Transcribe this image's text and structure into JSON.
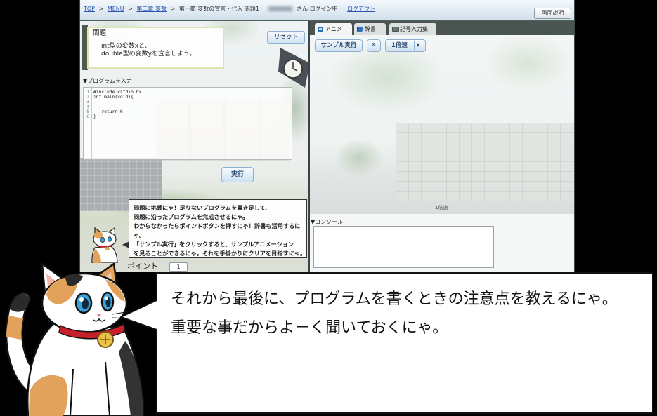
{
  "app": {
    "breadcrumb": {
      "top": "TOP",
      "sep1": ">",
      "menu": "MENU",
      "sep2": ">",
      "chapter": "第二章 変数",
      "sep3": ">",
      "section": "第一節 変数の宣言・代入 問題1",
      "user_suffix": "さん ログイン中",
      "logout": "ログアウト"
    },
    "help_button": "画面説明"
  },
  "editor_panel": {
    "problem": {
      "heading": "問題",
      "lines": [
        "int型の変数xと、",
        "double型の変数yを宣言しよう。"
      ]
    },
    "reset_button": "リセット",
    "program_label": "▼プログラムを入力",
    "code": {
      "line_numbers": [
        "1",
        "2",
        "3",
        "4",
        "5",
        "6"
      ],
      "lines": [
        "#include <stdio.h>",
        "int main(void){",
        "",
        "",
        "   return 0;",
        "}"
      ]
    },
    "run_button": "実行",
    "hint_lines": [
      "問題に挑戦にゃ！足りないプログラムを書き足して、",
      "問題に沿ったプログラムを完成させるにゃ。",
      "わからなかったらポイントボタンを押すにゃ！辞書も活用するに",
      "ゃ。",
      "「サンプル実行」をクリックすると、サンプルアニメーション",
      "を見ることができるにゃ。それを手掛かりにクリアを目指すにゃ。"
    ],
    "point": {
      "label": "ポイント",
      "value": "1"
    }
  },
  "animation_panel": {
    "tabs": [
      {
        "label": "アニメ",
        "icon": "film-icon",
        "selected": true
      },
      {
        "label": "辞書",
        "icon": "book-icon",
        "selected": false
      },
      {
        "label": "記号入力集",
        "icon": "keyboard-icon",
        "selected": false
      }
    ],
    "sample_run_button": "サンプル実行",
    "fast_forward_button": "»",
    "speed_select": "1倍速",
    "speed_indicator": "1倍速",
    "console_label": "▼コンソール"
  },
  "narration": {
    "lines": [
      "それから最後に、プログラムを書くときの注意点を教えるにゃ。",
      "重要な事だからよ－く聞いておくにゃ。"
    ]
  },
  "colors": {
    "link": "#2a55b5",
    "button_text": "#2a4a6e",
    "bubble_border": "#111111",
    "cat_collar": "#c8202a",
    "cat_eye": "#3aa3d8"
  }
}
